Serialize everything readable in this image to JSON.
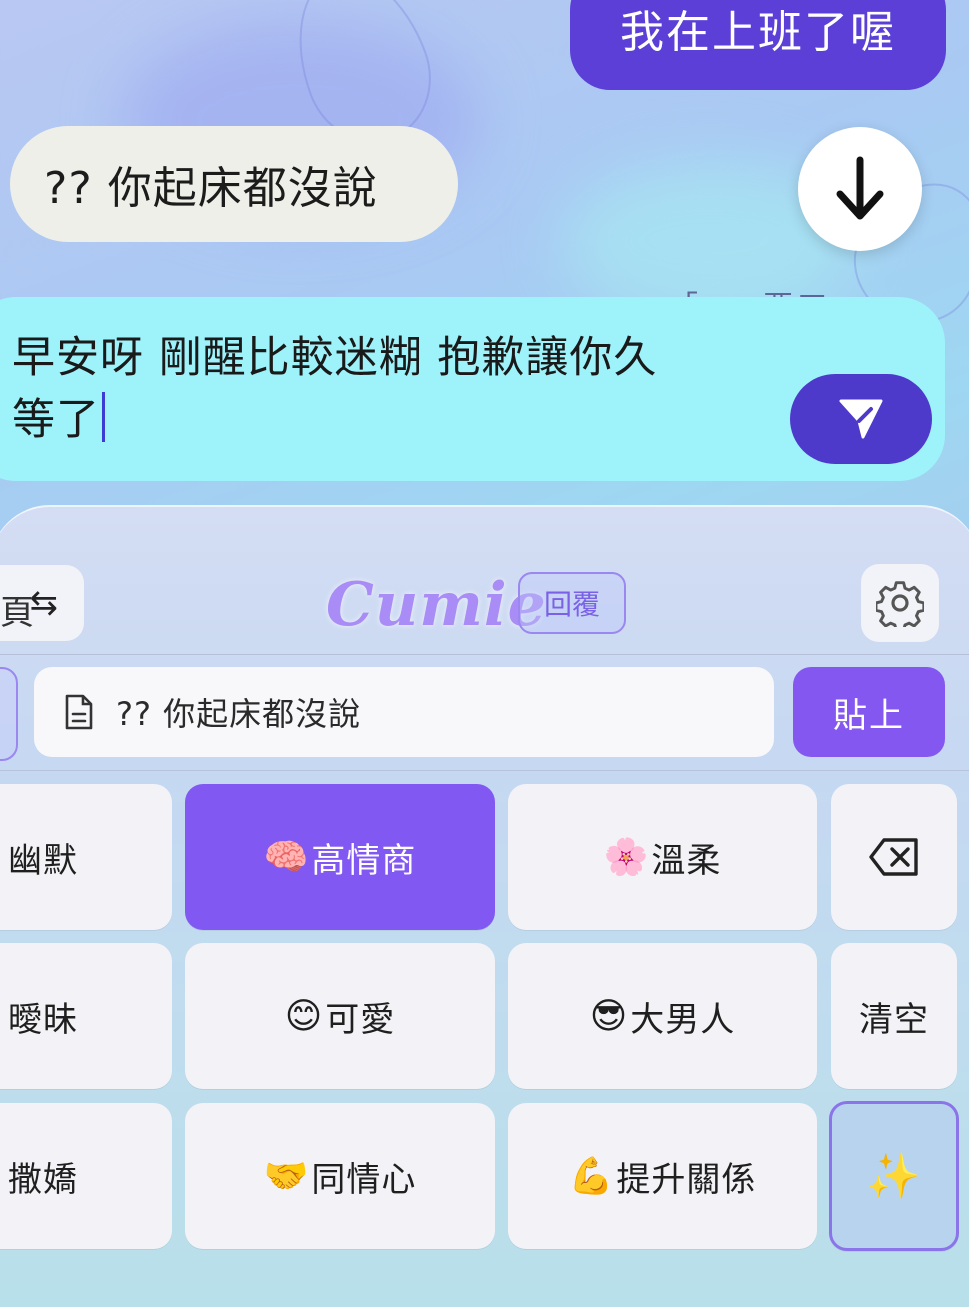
{
  "chat": {
    "outgoing_message": "我在上班了喔",
    "incoming_message": "?? 你起床都沒說",
    "scroll_icon": "arrow-down-icon",
    "faint_preview": "「 ～ 要工 ～ 」"
  },
  "composer": {
    "line1": "早安呀 剛醒比較迷糊 抱歉讓你久",
    "line2": "等了",
    "send_icon": "paper-plane-icon"
  },
  "keyboard": {
    "swap_label": "⇆",
    "brand": "Cumie",
    "mode_badge": "回覆",
    "settings_icon": "gear-icon",
    "clipboard_text": "?? 你起床都沒說",
    "paste_label": "貼上",
    "keys": {
      "humor": "幽默",
      "eq_emoji": "🧠",
      "eq": "高情商",
      "gentle_emoji": "🌸",
      "gentle": "溫柔",
      "flirty": "曖昧",
      "cute_emoji": "😊",
      "cute": "可愛",
      "macho_emoji": "😎",
      "macho": "大男人",
      "clear": "清空",
      "coquettish": "撒嬌",
      "empathy_emoji": "🤝",
      "empathy": "同情心",
      "relationship_emoji": "💪",
      "relationship": "提升關係",
      "sparkle": "✨"
    }
  },
  "colors": {
    "accent_purple": "#8258f2",
    "send_purple": "#4d3acb",
    "composer_cyan": "#9ef3fb"
  }
}
